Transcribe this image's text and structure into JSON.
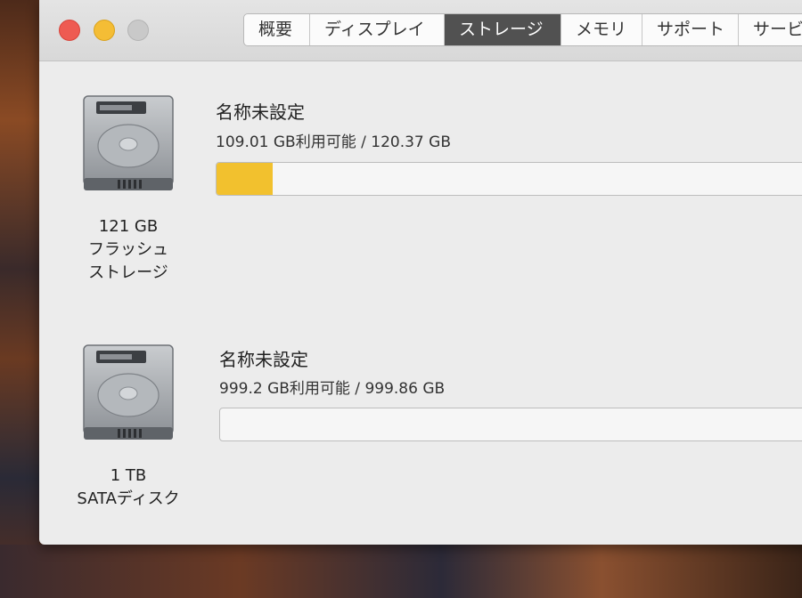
{
  "tabs": [
    {
      "label": "概要"
    },
    {
      "label": "ディスプレイ"
    },
    {
      "label": "ストレージ"
    },
    {
      "label": "メモリ"
    },
    {
      "label": "サポート"
    },
    {
      "label": "サービ"
    }
  ],
  "active_tab": "ストレージ",
  "drives": [
    {
      "icon": "hard-drive-icon",
      "capacity": "121 GB",
      "type_line1": "フラッシュ",
      "type_line2": "ストレージ",
      "volume_name": "名称未設定",
      "availability": "109.01 GB利用可能 / 120.37 GB",
      "used_fraction": 0.094,
      "used_color": "#f2c12e"
    },
    {
      "icon": "hard-drive-icon",
      "capacity": "1 TB",
      "type_line1": "SATAディスク",
      "volume_name": "名称未設定",
      "availability": "999.2 GB利用可能 / 999.86 GB",
      "used_fraction": 0.0,
      "used_color": "#f2c12e"
    }
  ],
  "colors": {
    "window_bg": "#ececec",
    "active_tab_bg": "#515151",
    "close": "#ee5b52",
    "minimize": "#f4bd35",
    "zoom": "#c9c9c9"
  }
}
